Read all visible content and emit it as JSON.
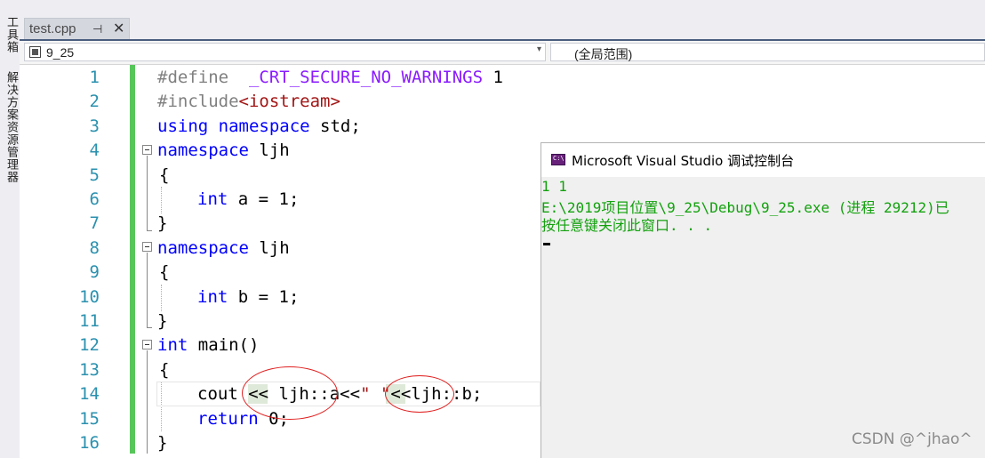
{
  "left_panel": {
    "toolbox": "工具箱",
    "solution_explorer": "解决方案资源管理器"
  },
  "tab": {
    "label": "test.cpp",
    "pin": "⊣",
    "close": "✕"
  },
  "nav": {
    "scope": "9_25",
    "global_scope": "(全局范围)",
    "dropdown_arrow": "▾"
  },
  "line_numbers": [
    "1",
    "2",
    "3",
    "4",
    "5",
    "6",
    "7",
    "8",
    "9",
    "10",
    "11",
    "12",
    "13",
    "14",
    "15",
    "16"
  ],
  "code": {
    "l1": {
      "directive": "#define  ",
      "macro": "_CRT_SECURE_NO_WARNINGS",
      "value": " 1"
    },
    "l2": {
      "directive": "#include",
      "header": "<iostream>"
    },
    "l3": {
      "kw": "using namespace",
      "rest": " std;"
    },
    "l4": {
      "kw": "namespace",
      "rest": " ljh"
    },
    "l5": "{",
    "l6": {
      "kw": "int",
      "rest": " a = 1;"
    },
    "l7": "}",
    "l8": {
      "kw": "namespace",
      "rest": " ljh"
    },
    "l9": "{",
    "l10": {
      "kw": "int",
      "rest": " b = 1;"
    },
    "l11": "}",
    "l12": {
      "kw": "int",
      "rest": " main()"
    },
    "l13": "{",
    "l14": {
      "a": "cout ",
      "op1": "<<",
      "b": " ljh::a",
      "op2": "<<",
      "str": "\" \"",
      "op3": "<<",
      "c": "ljh::b;"
    },
    "l15": {
      "kw": "return",
      "rest": " 0;"
    },
    "l16": "}"
  },
  "console": {
    "title": "Microsoft Visual Studio 调试控制台",
    "lines": [
      "1 1",
      "E:\\2019项目位置\\9_25\\Debug\\9_25.exe (进程 29212)已",
      "按任意键关闭此窗口. . ."
    ]
  },
  "watermark": "CSDN @^jhao^"
}
